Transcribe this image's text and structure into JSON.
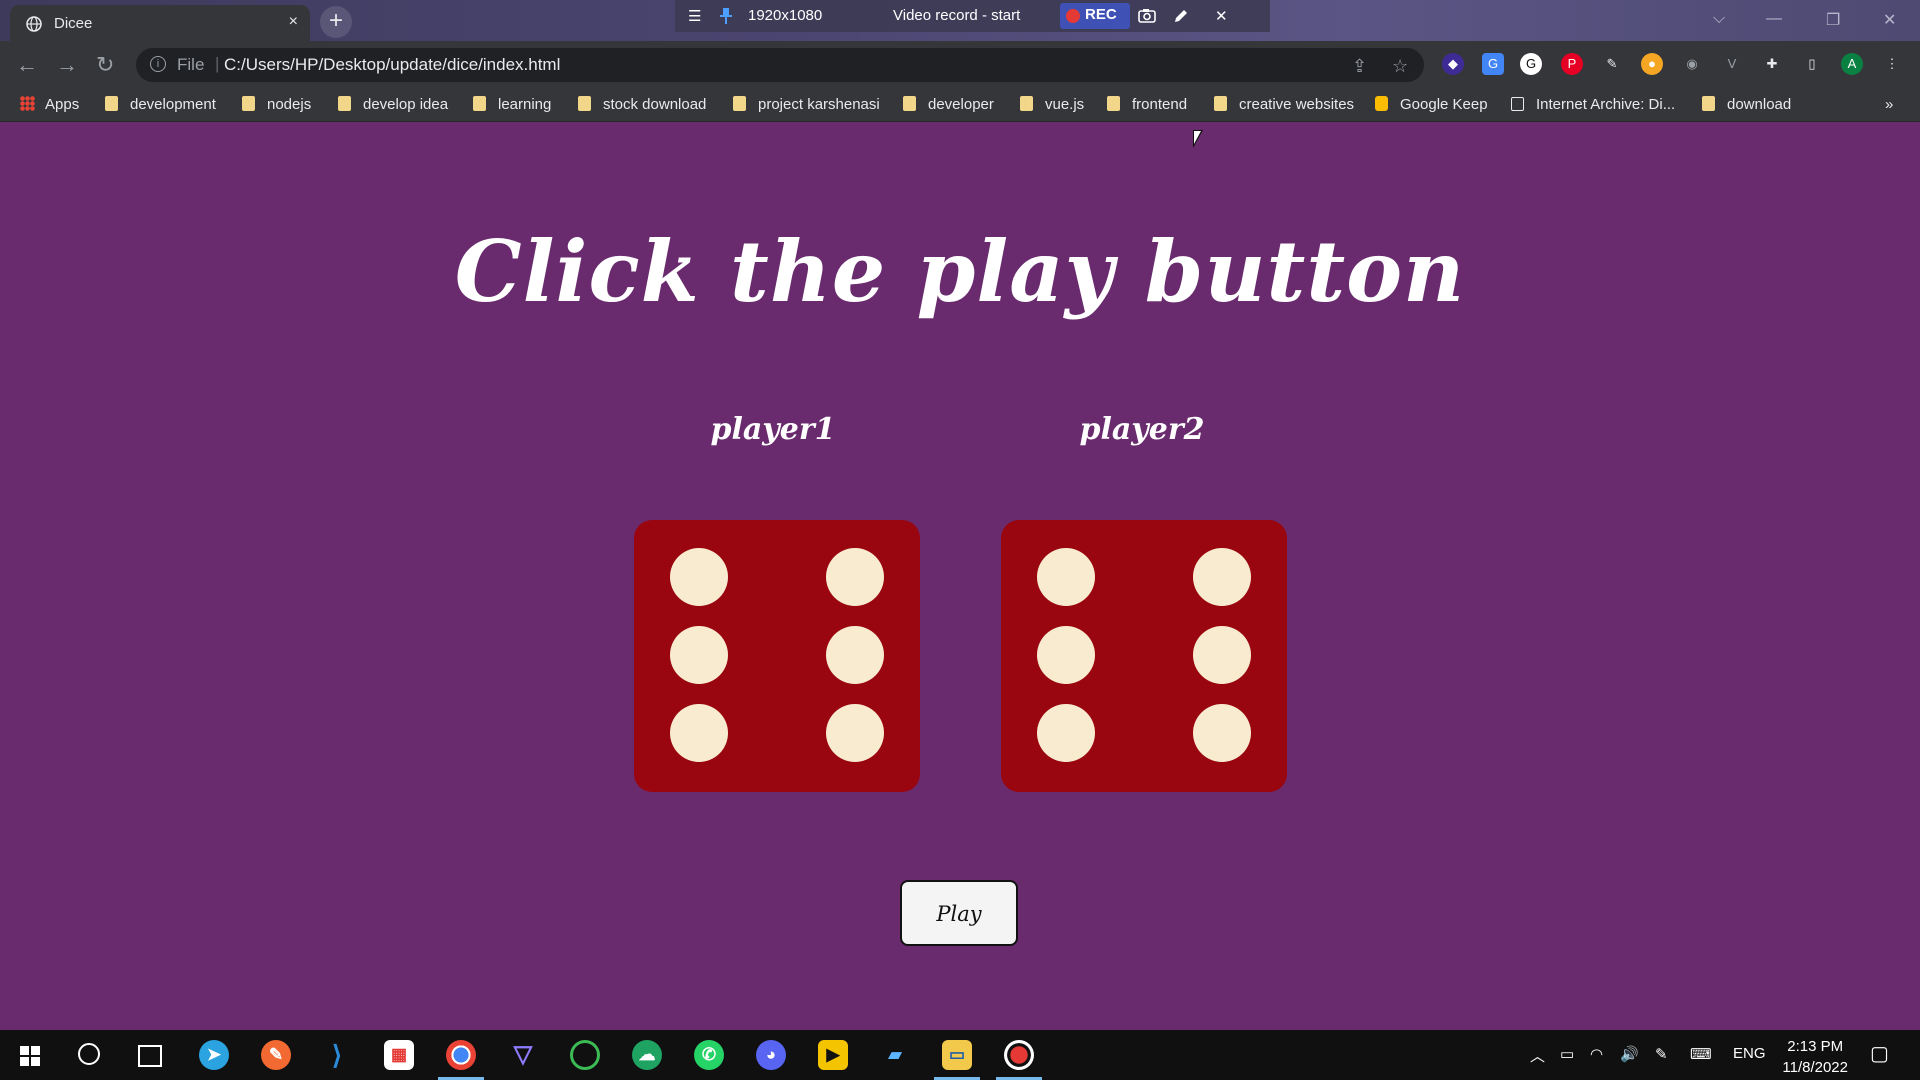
{
  "browser": {
    "tab_title": "Dicee",
    "tab_close": "×",
    "new_tab": "+",
    "address_scheme": "File",
    "address_url": "C:/Users/HP/Desktop/update/dice/index.html",
    "extension_avatar": "A"
  },
  "recorder": {
    "menu": "☰",
    "pin": "📌",
    "resolution": "1920x1080",
    "status": "Video record - start",
    "rec_label": "REC",
    "close": "✕"
  },
  "bookmarks": [
    {
      "label": "Apps",
      "icon": "apps-grid-icon"
    },
    {
      "label": "development",
      "icon": "folder-icon"
    },
    {
      "label": "nodejs",
      "icon": "folder-icon"
    },
    {
      "label": "develop idea",
      "icon": "folder-icon"
    },
    {
      "label": "learning",
      "icon": "folder-icon"
    },
    {
      "label": "stock download",
      "icon": "folder-icon"
    },
    {
      "label": "project karshenasi",
      "icon": "folder-icon"
    },
    {
      "label": "developer",
      "icon": "folder-icon"
    },
    {
      "label": "vue.js",
      "icon": "folder-icon"
    },
    {
      "label": "frontend",
      "icon": "folder-icon"
    },
    {
      "label": "creative websites",
      "icon": "folder-icon"
    },
    {
      "label": "Google Keep",
      "icon": "google-keep-icon"
    },
    {
      "label": "Internet Archive: Di...",
      "icon": "archive-icon"
    },
    {
      "label": "download",
      "icon": "folder-icon"
    }
  ],
  "bookmarks_overflow": "»",
  "page": {
    "heading": "Click the play button",
    "player1_label": "player1",
    "player2_label": "player2",
    "player1_die_value": 6,
    "player2_die_value": 6,
    "play_button": "Play",
    "background_color": "#692b6e",
    "die_color": "#9a0610",
    "pip_color": "#f8ebcf"
  },
  "taskbar": {
    "language": "ENG",
    "time": "2:13 PM",
    "date": "11/8/2022"
  }
}
